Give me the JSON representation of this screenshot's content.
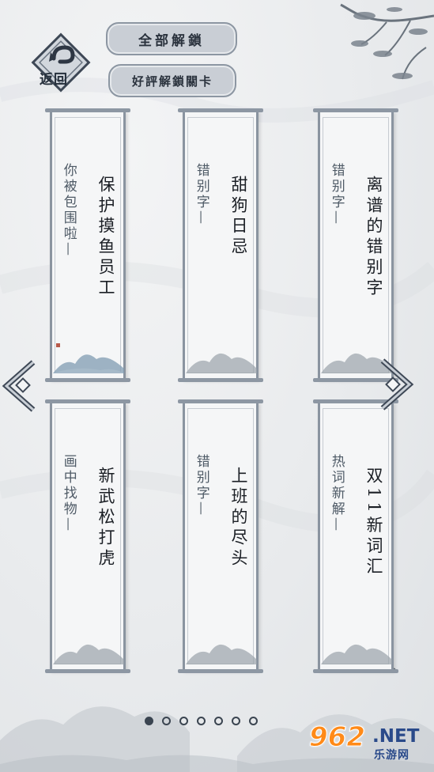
{
  "header": {
    "back_label": "返回",
    "unlock_all_label": "全部解鎖",
    "review_unlock_label": "好評解鎖關卡"
  },
  "levels": [
    {
      "title": "保护摸鱼员工",
      "subtitle": "你被包围啦—"
    },
    {
      "title": "甜狗日忌",
      "subtitle": "错别字—"
    },
    {
      "title": "离谱的错别字",
      "subtitle": "错别字—"
    },
    {
      "title": "新武松打虎",
      "subtitle": "画中找物—"
    },
    {
      "title": "上班的尽头",
      "subtitle": "错别字—"
    },
    {
      "title": "双11新词汇",
      "subtitle": "热词新解—"
    }
  ],
  "pagination": {
    "total": 7,
    "current": 1
  },
  "watermark": {
    "number": "962",
    "domain": ".NET",
    "site": "乐游网"
  },
  "colors": {
    "accent": "#8a94a0",
    "text": "#1b1f25",
    "watermark_orange": "#ff8a18",
    "watermark_blue": "#2a4a8a"
  }
}
